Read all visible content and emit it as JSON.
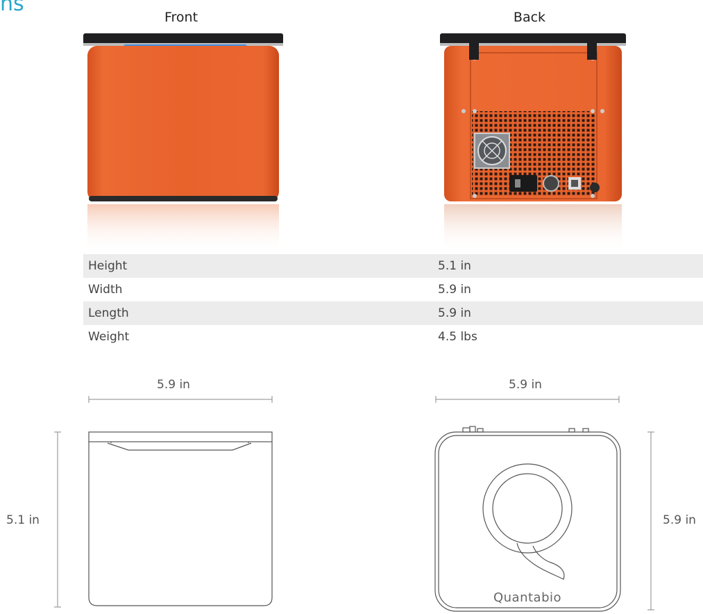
{
  "section": {
    "heading_fragment": "ns"
  },
  "views": {
    "front_label": "Front",
    "back_label": "Back"
  },
  "specs": [
    {
      "name": "Height",
      "value": "5.1 in"
    },
    {
      "name": "Width",
      "value": "5.9 in"
    },
    {
      "name": "Length",
      "value": "5.9 in"
    },
    {
      "name": "Weight",
      "value": "4.5 lbs"
    }
  ],
  "dimensions": {
    "front_width": "5.9 in",
    "front_height": "5.1 in",
    "top_width": "5.9 in",
    "top_depth": "5.9 in"
  },
  "logo": {
    "text": "Quantabio"
  },
  "colors": {
    "accent": "#2aa6c9",
    "device_orange": "#e8622c",
    "lid_black": "#1f1f22",
    "led_blue": "#3f8fe6",
    "row_shade": "#ececec"
  }
}
